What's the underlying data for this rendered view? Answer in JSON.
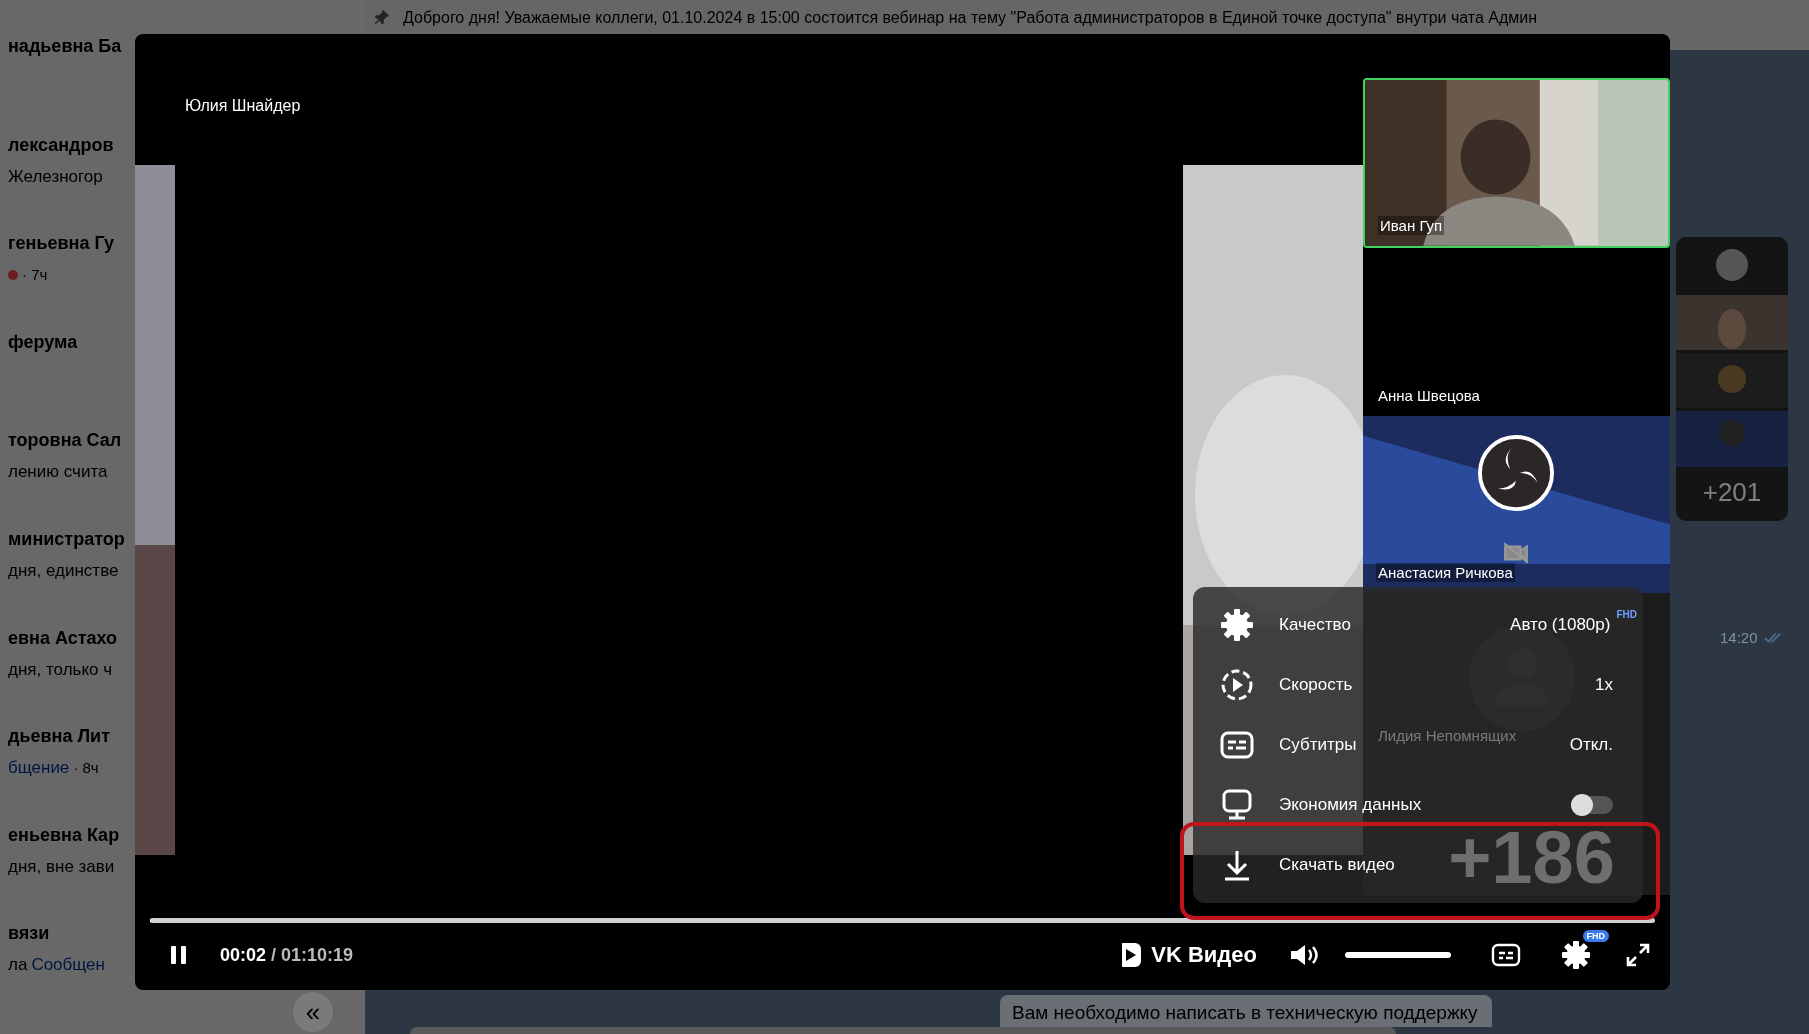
{
  "pinned_message": {
    "text": "Доброго дня! Уважаемые коллеги, 01.10.2024 в 15:00 состоится вебинар на тему \"Работа администраторов в Единой точке доступа\" внутри чата Админ"
  },
  "sidebar": {
    "chats": [
      {
        "name": "надьевна Ба"
      },
      {
        "name": "лександров",
        "preview": "Железногор"
      },
      {
        "name": "геньевна Гу",
        "heart": true,
        "time": "· 7ч"
      },
      {
        "name": "ферума"
      },
      {
        "name": "торовна Сал",
        "preview": "лению счита"
      },
      {
        "name": "министратор",
        "preview": "дня, единстве"
      },
      {
        "name": "евна Астахо",
        "preview": "дня, только ч"
      },
      {
        "name": "дьевна Лит",
        "link": "бщение",
        "time": "· 8ч"
      },
      {
        "name": "еньевна Кар",
        "preview": "дня, вне зави"
      },
      {
        "name": "вязи",
        "preview": "ла",
        "link": "Сообщен"
      }
    ],
    "collapse_button": "«"
  },
  "player": {
    "speaker_label": "Юлия Шнайдер",
    "participants": [
      {
        "name": "Иван Гуп",
        "kind": "camera",
        "speaking": true
      },
      {
        "name": "Анна Швецова",
        "kind": "blank",
        "speaking": false
      },
      {
        "name": "Анастасия Ричкова",
        "kind": "logo",
        "speaking": false
      },
      {
        "name": "Лидия Непомнящих",
        "kind": "avatar",
        "speaking": false
      }
    ],
    "more_count": "+186",
    "settings_menu": {
      "items": [
        {
          "kind": "quality",
          "label": "Качество",
          "value": "Авто (1080p)",
          "badge": "FHD"
        },
        {
          "kind": "speed",
          "label": "Скорость",
          "value": "1x"
        },
        {
          "kind": "subtitles",
          "label": "Субтитры",
          "value": "Откл."
        },
        {
          "kind": "toggle",
          "label": "Экономия данных",
          "on": false
        },
        {
          "kind": "download",
          "label": "Скачать видео"
        }
      ]
    },
    "progress": {
      "level": 0.0005
    },
    "time": {
      "current": "00:02",
      "total": "/ 01:10:19"
    },
    "logo": "VK Видео",
    "volume": {
      "level": 1
    },
    "settings_badge": "FHD"
  },
  "chat": {
    "participants_more": "+201",
    "message_time": "14:20",
    "message_text": "Вам необходимо написать в техническую поддержку"
  }
}
